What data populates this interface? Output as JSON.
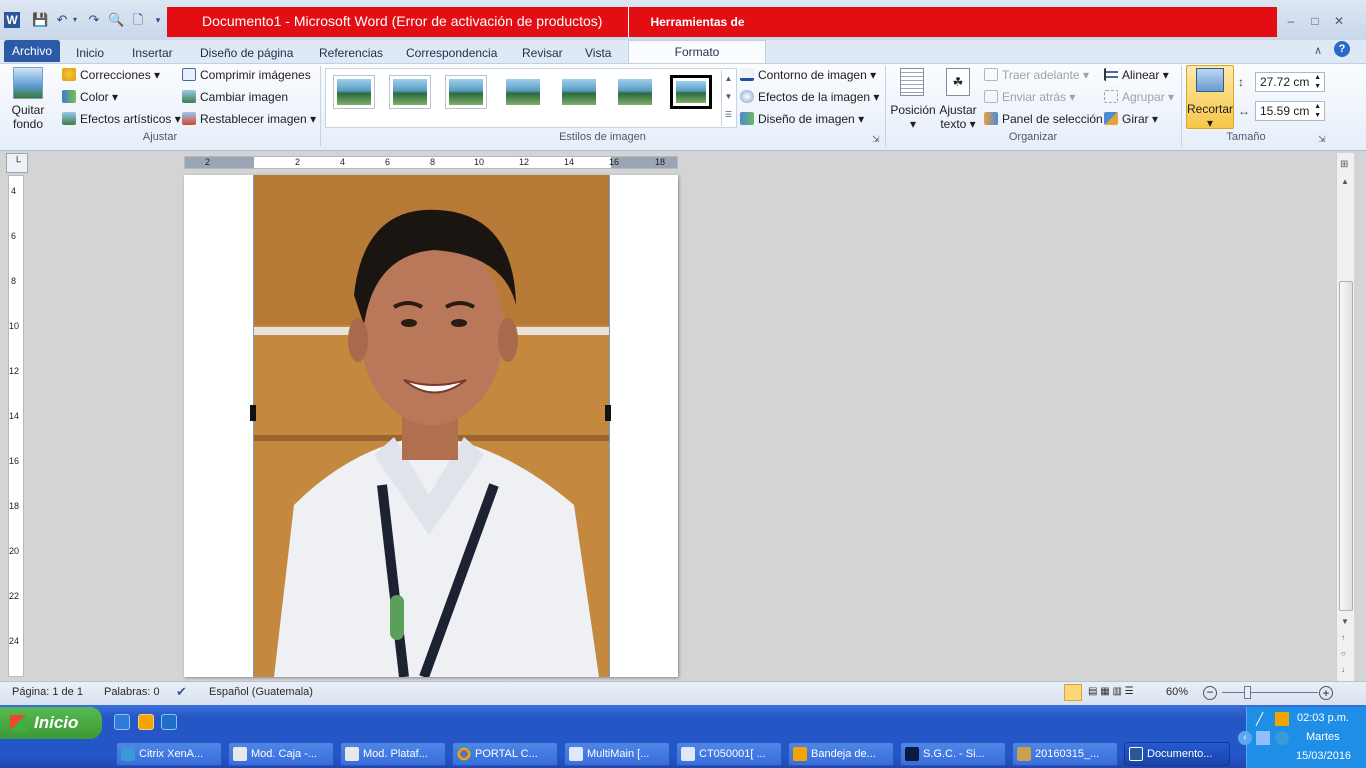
{
  "window": {
    "title": "Documento1 - Microsoft Word (Error de activación de productos)",
    "context_tab_group": "Herramientas de imagen"
  },
  "tabs": [
    "Archivo",
    "Inicio",
    "Insertar",
    "Diseño de página",
    "Referencias",
    "Correspondencia",
    "Revisar",
    "Vista",
    "Formato"
  ],
  "ribbon": {
    "ajustar": {
      "group": "Ajustar",
      "quitar_fondo": "Quitar\nfondo",
      "correcciones": "Correcciones",
      "color": "Color",
      "efectos_artisticos": "Efectos artísticos",
      "comprimir": "Comprimir imágenes",
      "cambiar": "Cambiar imagen",
      "restablecer": "Restablecer imagen"
    },
    "estilos": {
      "group": "Estilos de imagen",
      "contorno": "Contorno de imagen",
      "efectos": "Efectos de la imagen",
      "diseno": "Diseño de imagen"
    },
    "organizar": {
      "group": "Organizar",
      "posicion": "Posición",
      "ajustar_texto": "Ajustar\ntexto",
      "traer_adelante": "Traer adelante",
      "enviar_atras": "Enviar atrás",
      "panel": "Panel de selección",
      "alinear": "Alinear",
      "agrupar": "Agrupar",
      "girar": "Girar"
    },
    "tamano": {
      "group": "Tamaño",
      "recortar": "Recortar",
      "height": "27.72 cm",
      "width": "15.59 cm"
    }
  },
  "ruler": {
    "h_labels": [
      "2",
      "2",
      "4",
      "6",
      "8",
      "10",
      "12",
      "14",
      "16",
      "18"
    ],
    "v_labels": [
      "4",
      "6",
      "8",
      "10",
      "12",
      "14",
      "16",
      "18",
      "20",
      "22",
      "24"
    ]
  },
  "status": {
    "page": "Página: 1 de 1",
    "words": "Palabras: 0",
    "language": "Español (Guatemala)",
    "zoom": "60%"
  },
  "taskbar": {
    "start": "Inicio",
    "items": [
      "Citrix XenA...",
      "Mod. Caja -...",
      "Mod. Plataf...",
      "PORTAL C...",
      "MultiMain [...",
      "CT050001[ ...",
      "Bandeja de...",
      "S.G.C. - Si...",
      "20160315_...",
      "Documento..."
    ],
    "time": "02:03 p.m.",
    "day": "Martes",
    "date": "15/03/2016"
  }
}
